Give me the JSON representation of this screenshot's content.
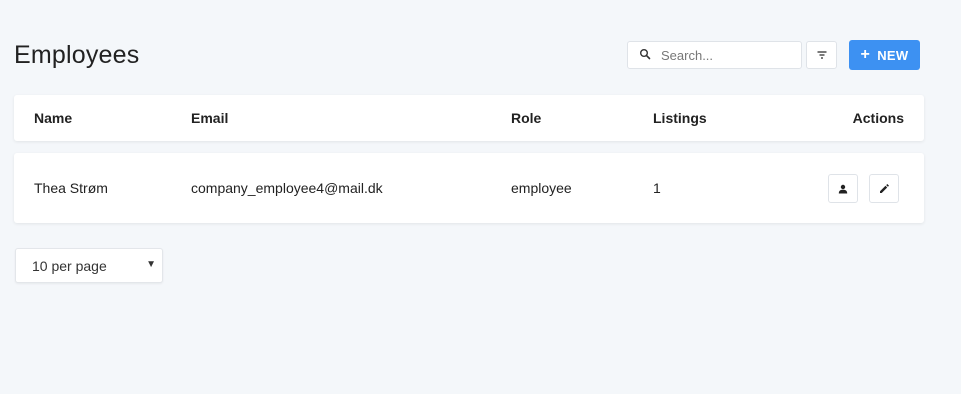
{
  "header": {
    "title": "Employees",
    "search_placeholder": "Search...",
    "new_label": "NEW",
    "new_plus": "+"
  },
  "colors": {
    "background": "#f4f7fa",
    "accent": "#3d91f2"
  },
  "table": {
    "columns": [
      "Name",
      "Email",
      "Role",
      "Listings",
      "Actions"
    ],
    "rows": [
      {
        "name": "Thea Strøm",
        "email": "company_employee4@mail.dk",
        "role": "employee",
        "listings": "1",
        "actions": [
          "person-icon",
          "edit-pencil-icon"
        ]
      }
    ]
  },
  "pagination": {
    "per_page": "10 per page",
    "caret": "▼"
  }
}
